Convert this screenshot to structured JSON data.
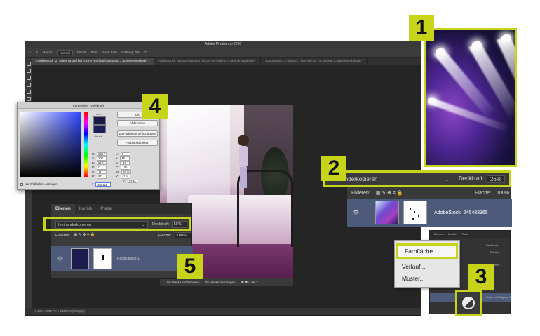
{
  "photoshop": {
    "title": "Adobe Photoshop 2020",
    "options_bar": [
      "Modus:",
      "Normal",
      "Deckkr.: 100%",
      "Fluss: 84%",
      "Glättung: 0%",
      "0°"
    ],
    "tabs": [
      "AdobeStock_271960975.psd bei 6,25% (Farbton/Sättigung 1, Ebenenmaske/8) *",
      "AdobeStock_489314895.jpeg bei 16,7% (Ebene 0, Ebenenmaske/8) *",
      "AdobeStock_475661917.jpeg bei 16,7% (Ebene 0, Ebenenmaske/8) *"
    ],
    "status": "6,25%   6699 Px x 4465 Px (300 ppi)",
    "doc_bottom": [
      "Von Maske subtrahieren",
      "Zu Maske hinzufügen"
    ]
  },
  "color_picker": {
    "title": "Farbwähler (Vollfarbe)",
    "new_label": "neu",
    "current_label": "aktuell",
    "buttons": [
      "OK",
      "Abbrechen",
      "Zu Farbfeldern hinzufügen",
      "Farbbibliotheken"
    ],
    "fields": [
      {
        "k": "H:",
        "v": "236 °",
        "k2": "L:",
        "v2": "6"
      },
      {
        "k": "S:",
        "v": "100 %",
        "k2": "a:",
        "v2": "15"
      },
      {
        "k": "B:",
        "v": "26 %",
        "k2": "b:",
        "v2": "-37"
      },
      {
        "k": "R:",
        "v": "0",
        "k2": "C:",
        "v2": "100 %"
      },
      {
        "k": "G:",
        "v": "11",
        "k2": "M:",
        "v2": "93 %"
      },
      {
        "k": "B:",
        "v": "67",
        "k2": "Y:",
        "v2": "41 %"
      },
      {
        "k": "",
        "v": "",
        "k2": "K:",
        "v2": "53 %"
      }
    ],
    "hex_label": "#",
    "hex": "000b43",
    "web_only": "Nur Webfarben anzeigen"
  },
  "layers_left": {
    "tabs": [
      "Ebenen",
      "Kanäle",
      "Pfade"
    ],
    "blend_mode": "Ineinanderkopieren",
    "opacity_label": "Deckkraft:",
    "opacity": "55%",
    "lock_label": "Fixieren:",
    "fill_label": "Fläche:",
    "fill": "100%",
    "layer_name": "Farbfüllung 1"
  },
  "layers_zoom": {
    "blend_mode": "Ineinanderkopieren",
    "opacity_label": "Deckkraft:",
    "opacity": "26%",
    "lock_label": "Fixieren:",
    "fill_label": "Fläche:",
    "fill": "100%",
    "layer_name": "AdobeStock_246483365"
  },
  "right_panel": {
    "tabs": [
      "Ebenen",
      "Kanäle",
      "Pfade"
    ],
    "rows": [
      "Deckkraft:",
      "Fläche:",
      "Ebene 1",
      "Farbton/Sättigung 1"
    ]
  },
  "context_menu": {
    "items": [
      "Farbfläche...",
      "Verlauf...",
      "Muster..."
    ]
  },
  "badges": [
    "1",
    "2",
    "3",
    "4",
    "5"
  ],
  "colors": {
    "accent": "#c8d418",
    "layer_selected": "#4d5a7a",
    "ps_dark": "#2b2b2b"
  }
}
